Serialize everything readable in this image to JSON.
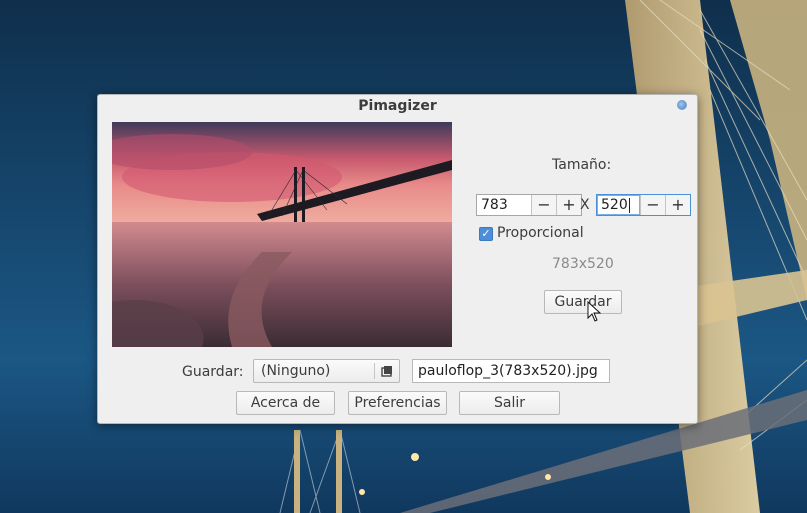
{
  "window": {
    "title": "Pimagizer"
  },
  "size": {
    "label": "Tamaño:",
    "width_value": "783",
    "height_value": "520",
    "separator": "X",
    "minus": "−",
    "plus": "+"
  },
  "proportional": {
    "label": "Proporcional",
    "checked": true
  },
  "dimensions_text": "783x520",
  "buttons": {
    "save": "Guardar",
    "about": "Acerca de",
    "preferences": "Preferencias",
    "exit": "Salir"
  },
  "save_row": {
    "label": "Guardar:",
    "folder_value": "(Ninguno)",
    "filename": "pauloflop_3(783x520).jpg"
  },
  "colors": {
    "accent": "#4e8ed8",
    "window_bg": "#efefef"
  }
}
